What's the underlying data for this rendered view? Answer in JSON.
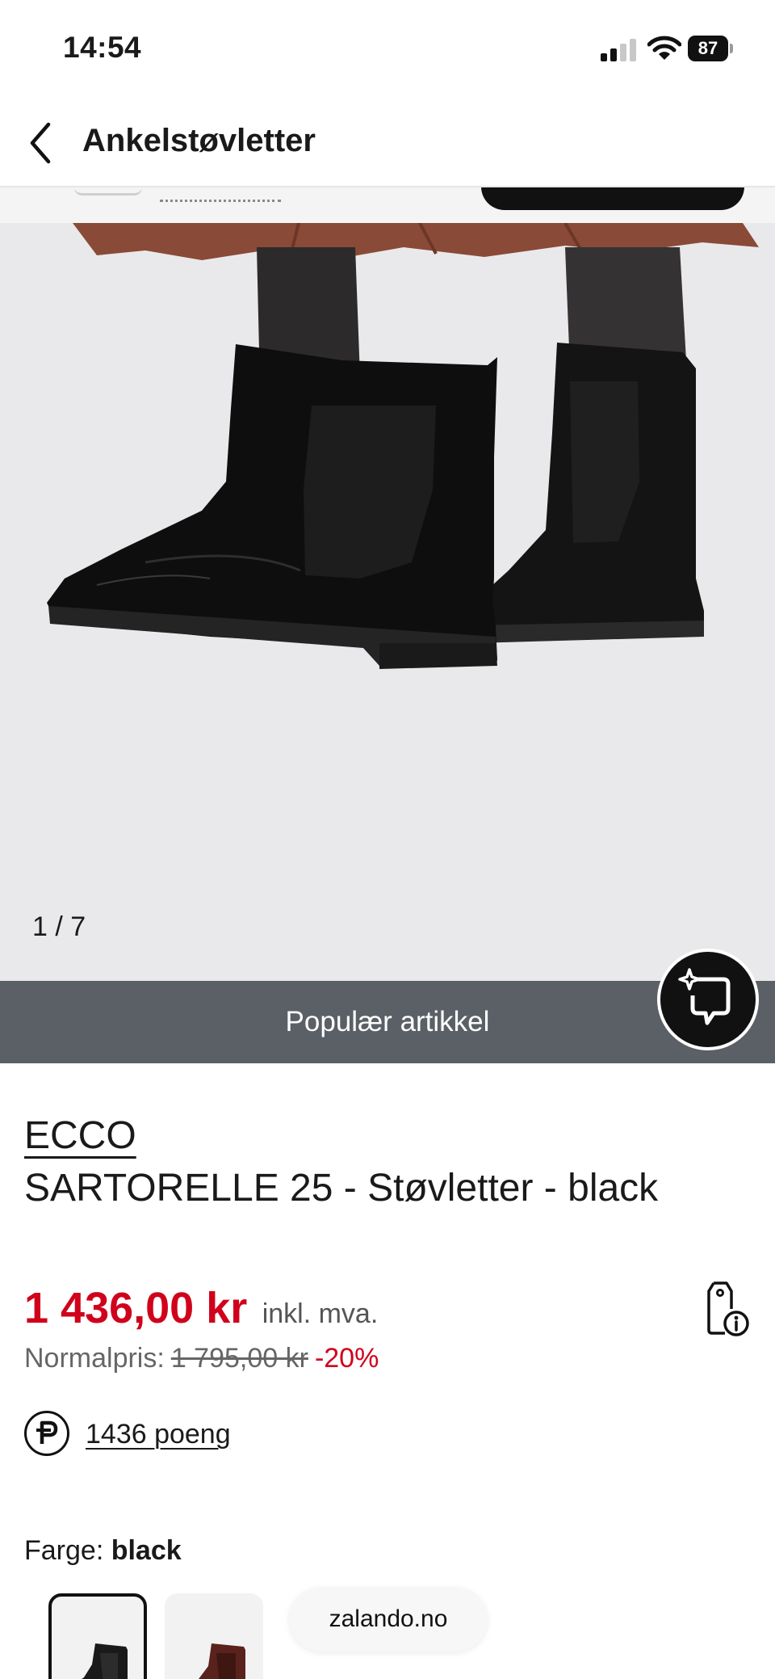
{
  "status_bar": {
    "time": "14:54",
    "battery": "87",
    "signal_bars_active": 2,
    "signal_bars_total": 4
  },
  "nav": {
    "title": "Ankelstøvletter",
    "back_icon": "chevron-left-icon"
  },
  "gallery": {
    "counter": "1 / 7",
    "background": "#e9e9eb"
  },
  "banner": {
    "label": "Populær artikkel",
    "background": "#5b6067"
  },
  "fab": {
    "icon": "sparkle-similar-icon"
  },
  "product": {
    "brand": "ECCO",
    "name": "SARTORELLE 25 - Støvletter - black",
    "price": "1 436,00 kr",
    "vat_note": "inkl. mva.",
    "normal_label": "Normalpris:",
    "normal_price": "1 795,00 kr",
    "discount": "-20%",
    "price_info_icon": "price-tag-info-icon",
    "points": "1436 poeng",
    "points_icon": "points-p-icon",
    "color_label": "Farge:",
    "color_value": "black",
    "accent_color": "#d0021b"
  },
  "footer_pill": {
    "label": "zalando.no"
  }
}
